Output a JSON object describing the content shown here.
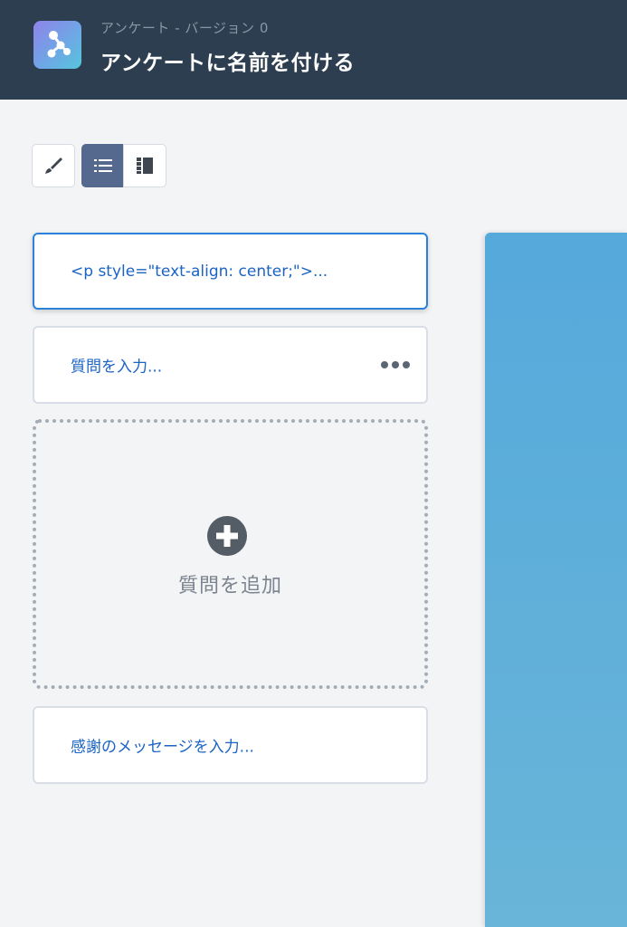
{
  "header": {
    "subtitle": "アンケート - バージョン 0",
    "title": "アンケートに名前を付ける",
    "icon": "survey-app-icon"
  },
  "toolbar": {
    "buttons": [
      {
        "icon": "paintbrush-icon",
        "selected": false
      },
      {
        "icon": "list-icon",
        "selected": true
      },
      {
        "icon": "layout-icon",
        "selected": false
      }
    ]
  },
  "pages": {
    "welcome_text": "<p style=\"text-align: center;\">...",
    "question_placeholder": "質問を入力...",
    "add_question_label": "質問を追加",
    "thanks_placeholder": "感謝のメッセージを入力..."
  },
  "colors": {
    "header_bg": "#2d3e50",
    "link_blue": "#1b63c4",
    "selected_border": "#2b82db",
    "preview_blue": "#55a9db"
  }
}
